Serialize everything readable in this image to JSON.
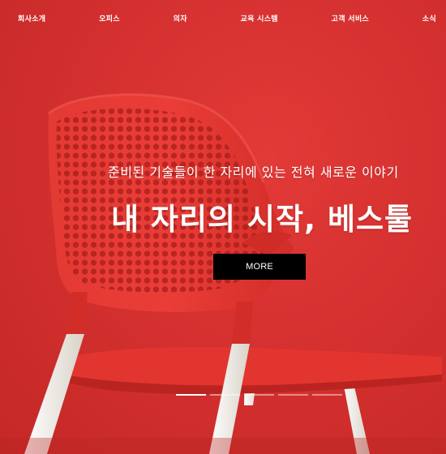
{
  "nav": {
    "items": [
      {
        "label": "회사소개"
      },
      {
        "label": "오피스"
      },
      {
        "label": "의자"
      },
      {
        "label": "교육 시스템"
      },
      {
        "label": "고객 서비스"
      },
      {
        "label": "소식"
      }
    ]
  },
  "hero": {
    "subtitle": "준비된 기술들이 한 자리에 있는 전혀 새로운 이야기",
    "headline": "내 자리의 시작, 베스툴",
    "button_label": "MORE",
    "slide_count": 5,
    "active_slide": 1
  },
  "colors": {
    "background": "#d8312f",
    "chair": "#e8302b",
    "legs": "#f1ede6",
    "button": "#000000"
  }
}
